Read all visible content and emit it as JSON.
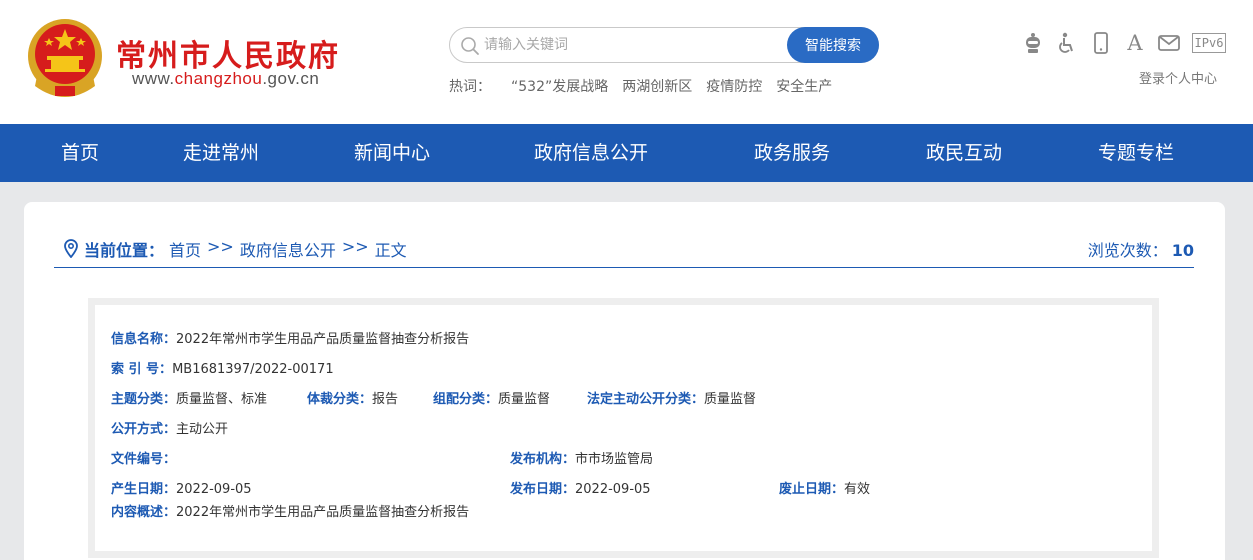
{
  "header": {
    "site_name": "常州市人民政府",
    "site_url_prefix": "www.",
    "site_url_brand": "changzhou",
    "site_url_suffix": ".gov.cn",
    "search": {
      "placeholder": "请输入关键词",
      "button_label": "智能搜索"
    },
    "hotwords": {
      "label": "热词：",
      "items": [
        "“532”发展战略",
        "两湖创新区",
        "疫情防控",
        "安全生产"
      ]
    },
    "tools": [
      "robot-icon",
      "accessibility-icon",
      "mobile-icon",
      "font-size-icon",
      "mail-icon",
      "ipv6-icon"
    ],
    "ipv6_label": "IPv6",
    "font_icon_label": "A",
    "login_label": "登录个人中心"
  },
  "nav": {
    "items": [
      "首页",
      "走进常州",
      "新闻中心",
      "政府信息公开",
      "政务服务",
      "政民互动",
      "专题专栏"
    ]
  },
  "breadcrumb": {
    "label": "当前位置：",
    "items": [
      "首页",
      ">>",
      "政府信息公开",
      ">>",
      "正文"
    ]
  },
  "views": {
    "label": "浏览次数：",
    "count": "10"
  },
  "info": {
    "name_label": "信息名称：",
    "name_value": "2022年常州市学生用品产品质量监督抽查分析报告",
    "index_label": "索 引 号：",
    "index_value": "MB1681397/2022-00171",
    "topic_label": "主题分类：",
    "topic_value": "质量监督、标准",
    "genre_label": "体裁分类：",
    "genre_value": "报告",
    "org_class_label": "组配分类：",
    "org_class_value": "质量监督",
    "legal_label": "法定主动公开分类：",
    "legal_value": "质量监督",
    "method_label": "公开方式：",
    "method_value": "主动公开",
    "docnum_label": "文件编号：",
    "docnum_value": "",
    "publisher_label": "发布机构：",
    "publisher_value": "市市场监管局",
    "created_label": "产生日期：",
    "created_value": "2022-09-05",
    "published_label": "发布日期：",
    "published_value": "2022-09-05",
    "expire_label": "废止日期：",
    "expire_value": "有效",
    "summary_label": "内容概述：",
    "summary_value": "2022年常州市学生用品产品质量监督抽查分析报告"
  },
  "colors": {
    "brand_red": "#d61c1c",
    "nav_blue": "#1d5ab3",
    "search_blue": "#2a6bc4"
  }
}
